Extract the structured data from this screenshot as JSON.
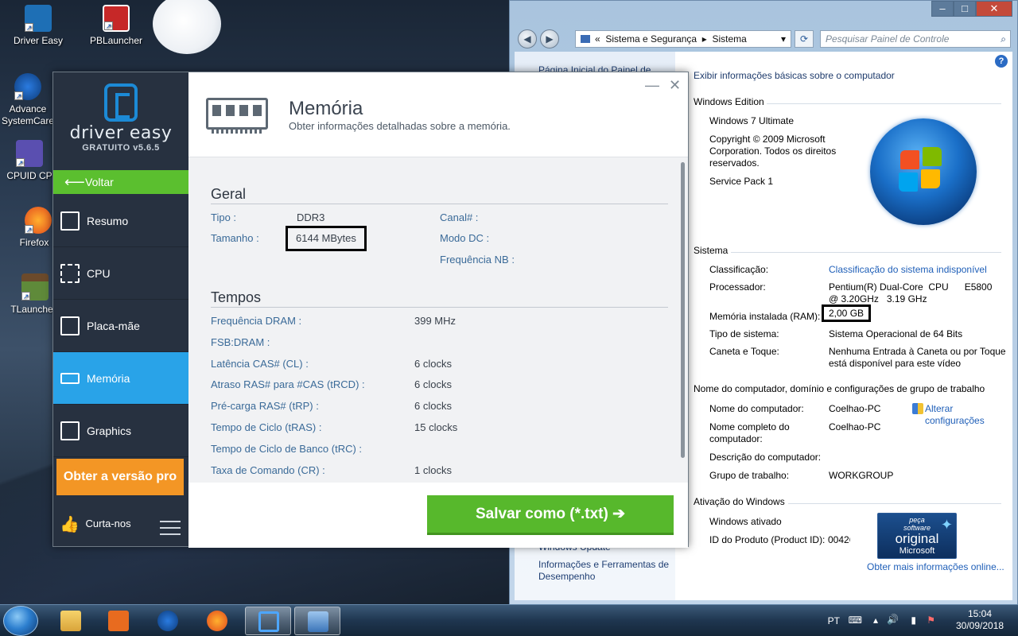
{
  "desktop": {
    "icons": [
      {
        "label": "Driver Easy"
      },
      {
        "label": "PBLauncher"
      },
      {
        "label": "Advance SystemCare"
      },
      {
        "label": "CPUID CP"
      },
      {
        "label": "Firefox"
      },
      {
        "label": "TLauncher"
      }
    ]
  },
  "control_panel": {
    "breadcrumb": {
      "sep": "«",
      "part1": "Sistema e Segurança",
      "arrow": "▸",
      "part2": "Sistema"
    },
    "search_placeholder": "Pesquisar Painel de Controle",
    "left_links": {
      "home": "Página Inicial do Painel de",
      "windows_update": "Windows Update",
      "perf": "Informações e Ferramentas de Desempenho"
    },
    "title": "Exibir informações básicas sobre o computador",
    "edition": {
      "section": "Windows Edition",
      "name": "Windows 7 Ultimate",
      "copyright": "Copyright © 2009 Microsoft Corporation. Todos os direitos reservados.",
      "sp": "Service Pack 1"
    },
    "system": {
      "section": "Sistema",
      "rating_label": "Classificação:",
      "rating_value": "Classificação do sistema indisponível",
      "proc_label": "Processador:",
      "proc_value": "Pentium(R) Dual-Core  CPU      E5800  @ 3.20GHz   3.19 GHz",
      "ram_label": "Memória instalada (RAM):",
      "ram_value": "2,00 GB",
      "type_label": "Tipo de sistema:",
      "type_value": "Sistema Operacional de 64 Bits",
      "pen_label": "Caneta e Toque:",
      "pen_value": "Nenhuma Entrada à Caneta ou por Toque está disponível para este vídeo"
    },
    "computer": {
      "section": "Nome do computador, domínio e configurações de grupo de trabalho",
      "name_label": "Nome do computador:",
      "name_value": "Coelhao-PC",
      "full_label": "Nome completo do computador:",
      "full_value": "Coelhao-PC",
      "desc_label": "Descrição do computador:",
      "group_label": "Grupo de trabalho:",
      "group_value": "WORKGROUP",
      "change": "Alterar configurações"
    },
    "activation": {
      "section": "Ativação do Windows",
      "status": "Windows ativado",
      "pid_label": "ID do Produto (Product ID):",
      "pid_value": "00426",
      "more": "Obter mais informações online...",
      "badge_line1": "peça",
      "badge_line2": "software",
      "badge_line3": "original",
      "badge_line4": "Microsoft"
    },
    "help": "?"
  },
  "driver_easy": {
    "brand": "driver easy",
    "version": "GRATUITO v5.6.5",
    "back": "Voltar",
    "nav": [
      {
        "label": "Resumo"
      },
      {
        "label": "CPU"
      },
      {
        "label": "Placa-mãe"
      },
      {
        "label": "Memória"
      },
      {
        "label": "Graphics"
      }
    ],
    "pro_button": "Obter a versão pro",
    "like": "Curta-nos",
    "header": {
      "title": "Memória",
      "subtitle": "Obter informações detalhadas sobre a memória."
    },
    "geral": {
      "title": "Geral",
      "tipo_label": "Tipo :",
      "tipo_value": "DDR3",
      "tamanho_label": "Tamanho :",
      "tamanho_value": "6144 MBytes",
      "canal_label": "Canal# :",
      "modo_label": "Modo DC :",
      "freqnb_label": "Frequência NB :"
    },
    "tempos": {
      "title": "Tempos",
      "rows": [
        {
          "label": "Frequência DRAM :",
          "value": "399 MHz"
        },
        {
          "label": "FSB:DRAM :",
          "value": ""
        },
        {
          "label": "Latência CAS# (CL) :",
          "value": "6 clocks"
        },
        {
          "label": "Atraso RAS# para #CAS (tRCD) :",
          "value": "6 clocks"
        },
        {
          "label": "Pré-carga RAS# (tRP) :",
          "value": "6 clocks"
        },
        {
          "label": "Tempo de Ciclo (tRAS) :",
          "value": "15 clocks"
        },
        {
          "label": "Tempo de Ciclo de Banco (tRC) :",
          "value": ""
        },
        {
          "label": "Taxa de Comando (CR) :",
          "value": "1 clocks"
        }
      ]
    },
    "save_button": "Salvar como (*.txt)  ➔"
  },
  "taskbar": {
    "lang": "PT",
    "time": "15:04",
    "date": "30/09/2018"
  }
}
